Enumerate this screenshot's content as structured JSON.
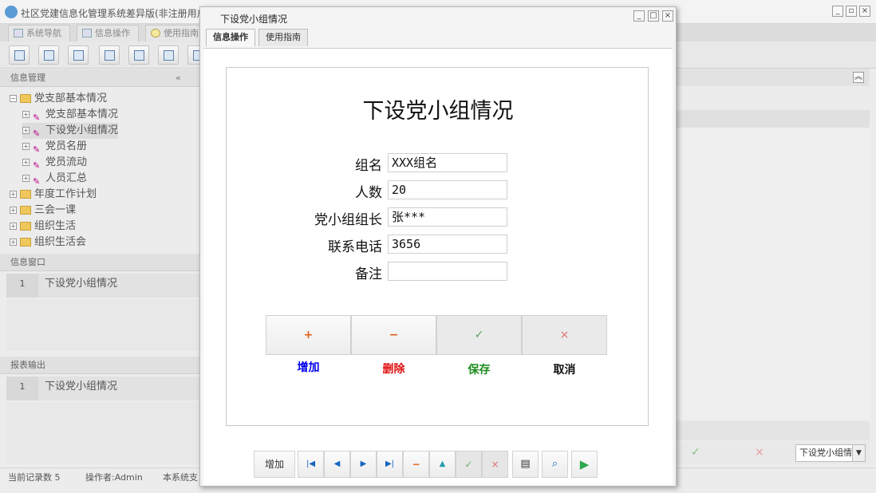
{
  "app": {
    "title": "社区党建信息化管理系统差异版(非注册用户)"
  },
  "main_tabs": [
    {
      "label": "系统导航"
    },
    {
      "label": "信息操作"
    },
    {
      "label": "使用指南"
    }
  ],
  "left": {
    "info_mgmt": "信息管理",
    "tree": [
      {
        "label": "党支部基本情况",
        "type": "folder",
        "expander": "⊟"
      },
      {
        "label": "党支部基本情况",
        "type": "item",
        "expander": "⊞"
      },
      {
        "label": "下设党小组情况",
        "type": "item",
        "expander": "⊞",
        "selected": true
      },
      {
        "label": "党员名册",
        "type": "item",
        "expander": "⊞"
      },
      {
        "label": "党员流动",
        "type": "item",
        "expander": "⊞"
      },
      {
        "label": "人员汇总",
        "type": "item",
        "expander": "⊞"
      },
      {
        "label": "年度工作计划",
        "type": "folder",
        "expander": "⊞"
      },
      {
        "label": "三会一课",
        "type": "folder",
        "expander": "⊞"
      },
      {
        "label": "组织生活",
        "type": "folder",
        "expander": "⊞"
      },
      {
        "label": "组织生活会",
        "type": "folder",
        "expander": "⊞"
      }
    ],
    "info_window": {
      "title": "信息窗口",
      "row_num": "1",
      "row_text": "下设党小组情况"
    },
    "report": {
      "title": "报表输出",
      "row_num": "1",
      "row_text": "下设党小组情况"
    }
  },
  "status": {
    "records": "当前记录数 5",
    "operator": "操作者:Admin",
    "note": "本系统支"
  },
  "right_panel": {
    "combo_value": "下设党小组情"
  },
  "dialog": {
    "title": "下设党小组情况",
    "tabs": [
      {
        "label": "信息操作"
      },
      {
        "label": "使用指南"
      }
    ],
    "form_title": "下设党小组情况",
    "fields": [
      {
        "label": "组名",
        "value": "XXX组名"
      },
      {
        "label": "人数",
        "value": "20"
      },
      {
        "label": "党小组组长",
        "value": "张***"
      },
      {
        "label": "联系电话",
        "value": "3656"
      },
      {
        "label": "备注",
        "value": ""
      }
    ],
    "actions": [
      {
        "icon": "+",
        "label": "增加",
        "color": "#0000ee",
        "icon_color": "#e0601a"
      },
      {
        "icon": "−",
        "label": "删除",
        "color": "#e01010",
        "icon_color": "#e0601a"
      },
      {
        "icon": "✓",
        "label": "保存",
        "color": "#1a8a1a",
        "icon_color": "#5fa05f"
      },
      {
        "icon": "×",
        "label": "取消",
        "color": "#111111",
        "icon_color": "#e07070"
      }
    ],
    "nav_add_label": "增加"
  },
  "icons": {
    "first": "first-record-icon",
    "prev": "prev-record-icon",
    "next": "next-record-icon",
    "last": "last-record-icon",
    "print": "print-icon",
    "preview": "print-preview-icon",
    "run": "run-icon"
  }
}
